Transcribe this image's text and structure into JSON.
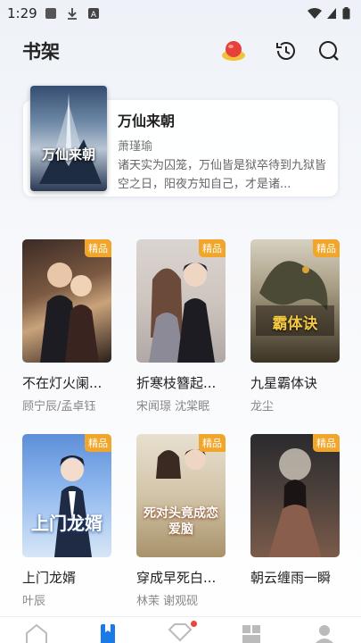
{
  "status": {
    "time": "1:29"
  },
  "header": {
    "title": "书架",
    "icons": [
      "gift-cake-icon",
      "history-icon",
      "search-icon"
    ]
  },
  "featured": {
    "title": "万仙来朝",
    "author": "萧瑾瑜",
    "description": "诸天实为囚笼，万仙皆是狱卒待到九狱皆空之日，阳夜方知自己，才是诸...",
    "cover_text": "万仙来朝"
  },
  "books": [
    {
      "title": "不在灯火阑...",
      "author": "顾宁辰/孟卓钰",
      "badge": "精品",
      "cover_text": ""
    },
    {
      "title": "折寒枝簪起...",
      "author": "宋闻璟  沈棠眠",
      "badge": "精品",
      "cover_text": ""
    },
    {
      "title": "九星霸体诀",
      "author": "龙尘",
      "badge": "精品",
      "cover_text": "霸体诀"
    },
    {
      "title": "上门龙婿",
      "author": "叶辰",
      "badge": "精品",
      "cover_text": "上门龙婿"
    },
    {
      "title": "穿成早死白...",
      "author": "林茉  谢观砚",
      "badge": "精品",
      "cover_text": "死对头竟成恋爱脑"
    },
    {
      "title": "朝云缠雨一瞬",
      "author": "",
      "badge": "精品",
      "cover_text": ""
    }
  ],
  "tabbar": {
    "items": [
      "home-icon",
      "bookshelf-icon",
      "welfare-icon",
      "category-icon",
      "profile-icon"
    ],
    "active": 1,
    "accent": "#1a7be6"
  }
}
